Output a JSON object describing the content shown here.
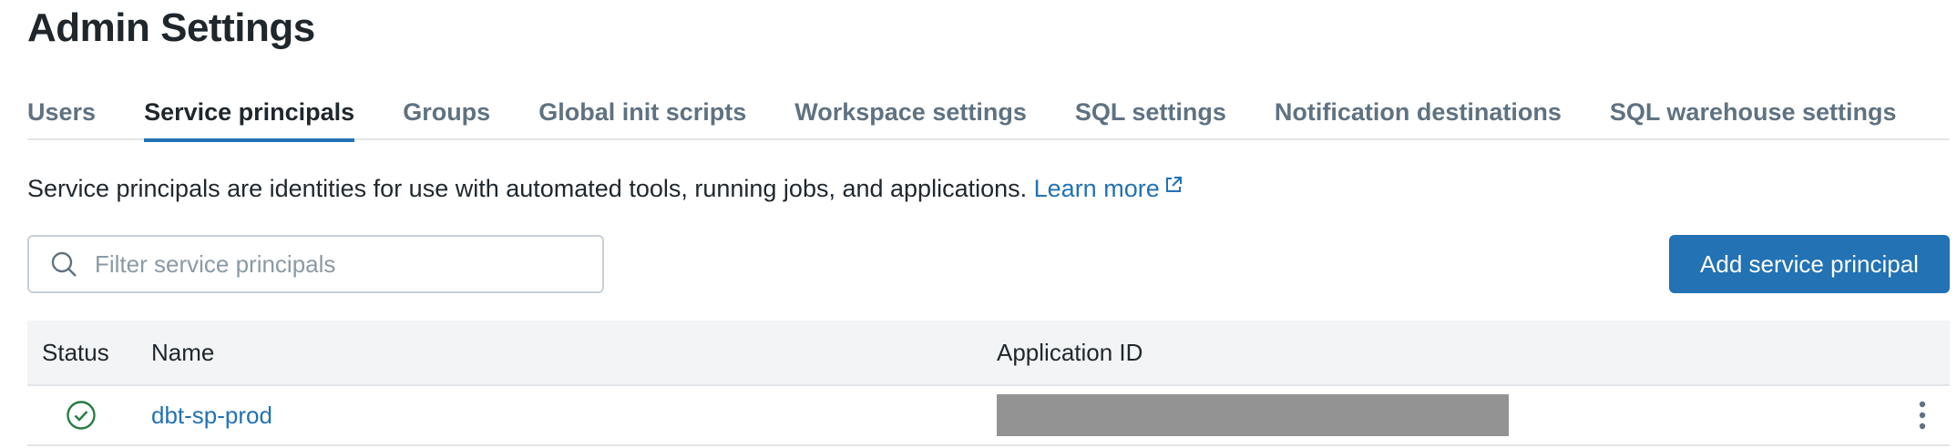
{
  "header": {
    "title": "Admin Settings"
  },
  "tabs": [
    {
      "label": "Users",
      "active": false
    },
    {
      "label": "Service principals",
      "active": true
    },
    {
      "label": "Groups",
      "active": false
    },
    {
      "label": "Global init scripts",
      "active": false
    },
    {
      "label": "Workspace settings",
      "active": false
    },
    {
      "label": "SQL settings",
      "active": false
    },
    {
      "label": "Notification destinations",
      "active": false
    },
    {
      "label": "SQL warehouse settings",
      "active": false
    }
  ],
  "description": {
    "text": "Service principals are identities for use with automated tools, running jobs, and applications.",
    "link_label": "Learn more",
    "link_icon": "external-link-icon"
  },
  "search": {
    "placeholder": "Filter service principals",
    "value": "",
    "icon": "search-icon"
  },
  "toolbar": {
    "add_label": "Add service principal"
  },
  "table": {
    "columns": [
      "Status",
      "Name",
      "Application ID"
    ],
    "rows": [
      {
        "status_icon": "check-circle-icon",
        "name": "dbt-sp-prod",
        "application_id_redacted": true,
        "actions_icon": "kebab-menu-icon"
      }
    ]
  },
  "colors": {
    "accent": "#2272b4",
    "success": "#277c43",
    "muted_tab": "#5f7281",
    "redaction": "#939393"
  }
}
